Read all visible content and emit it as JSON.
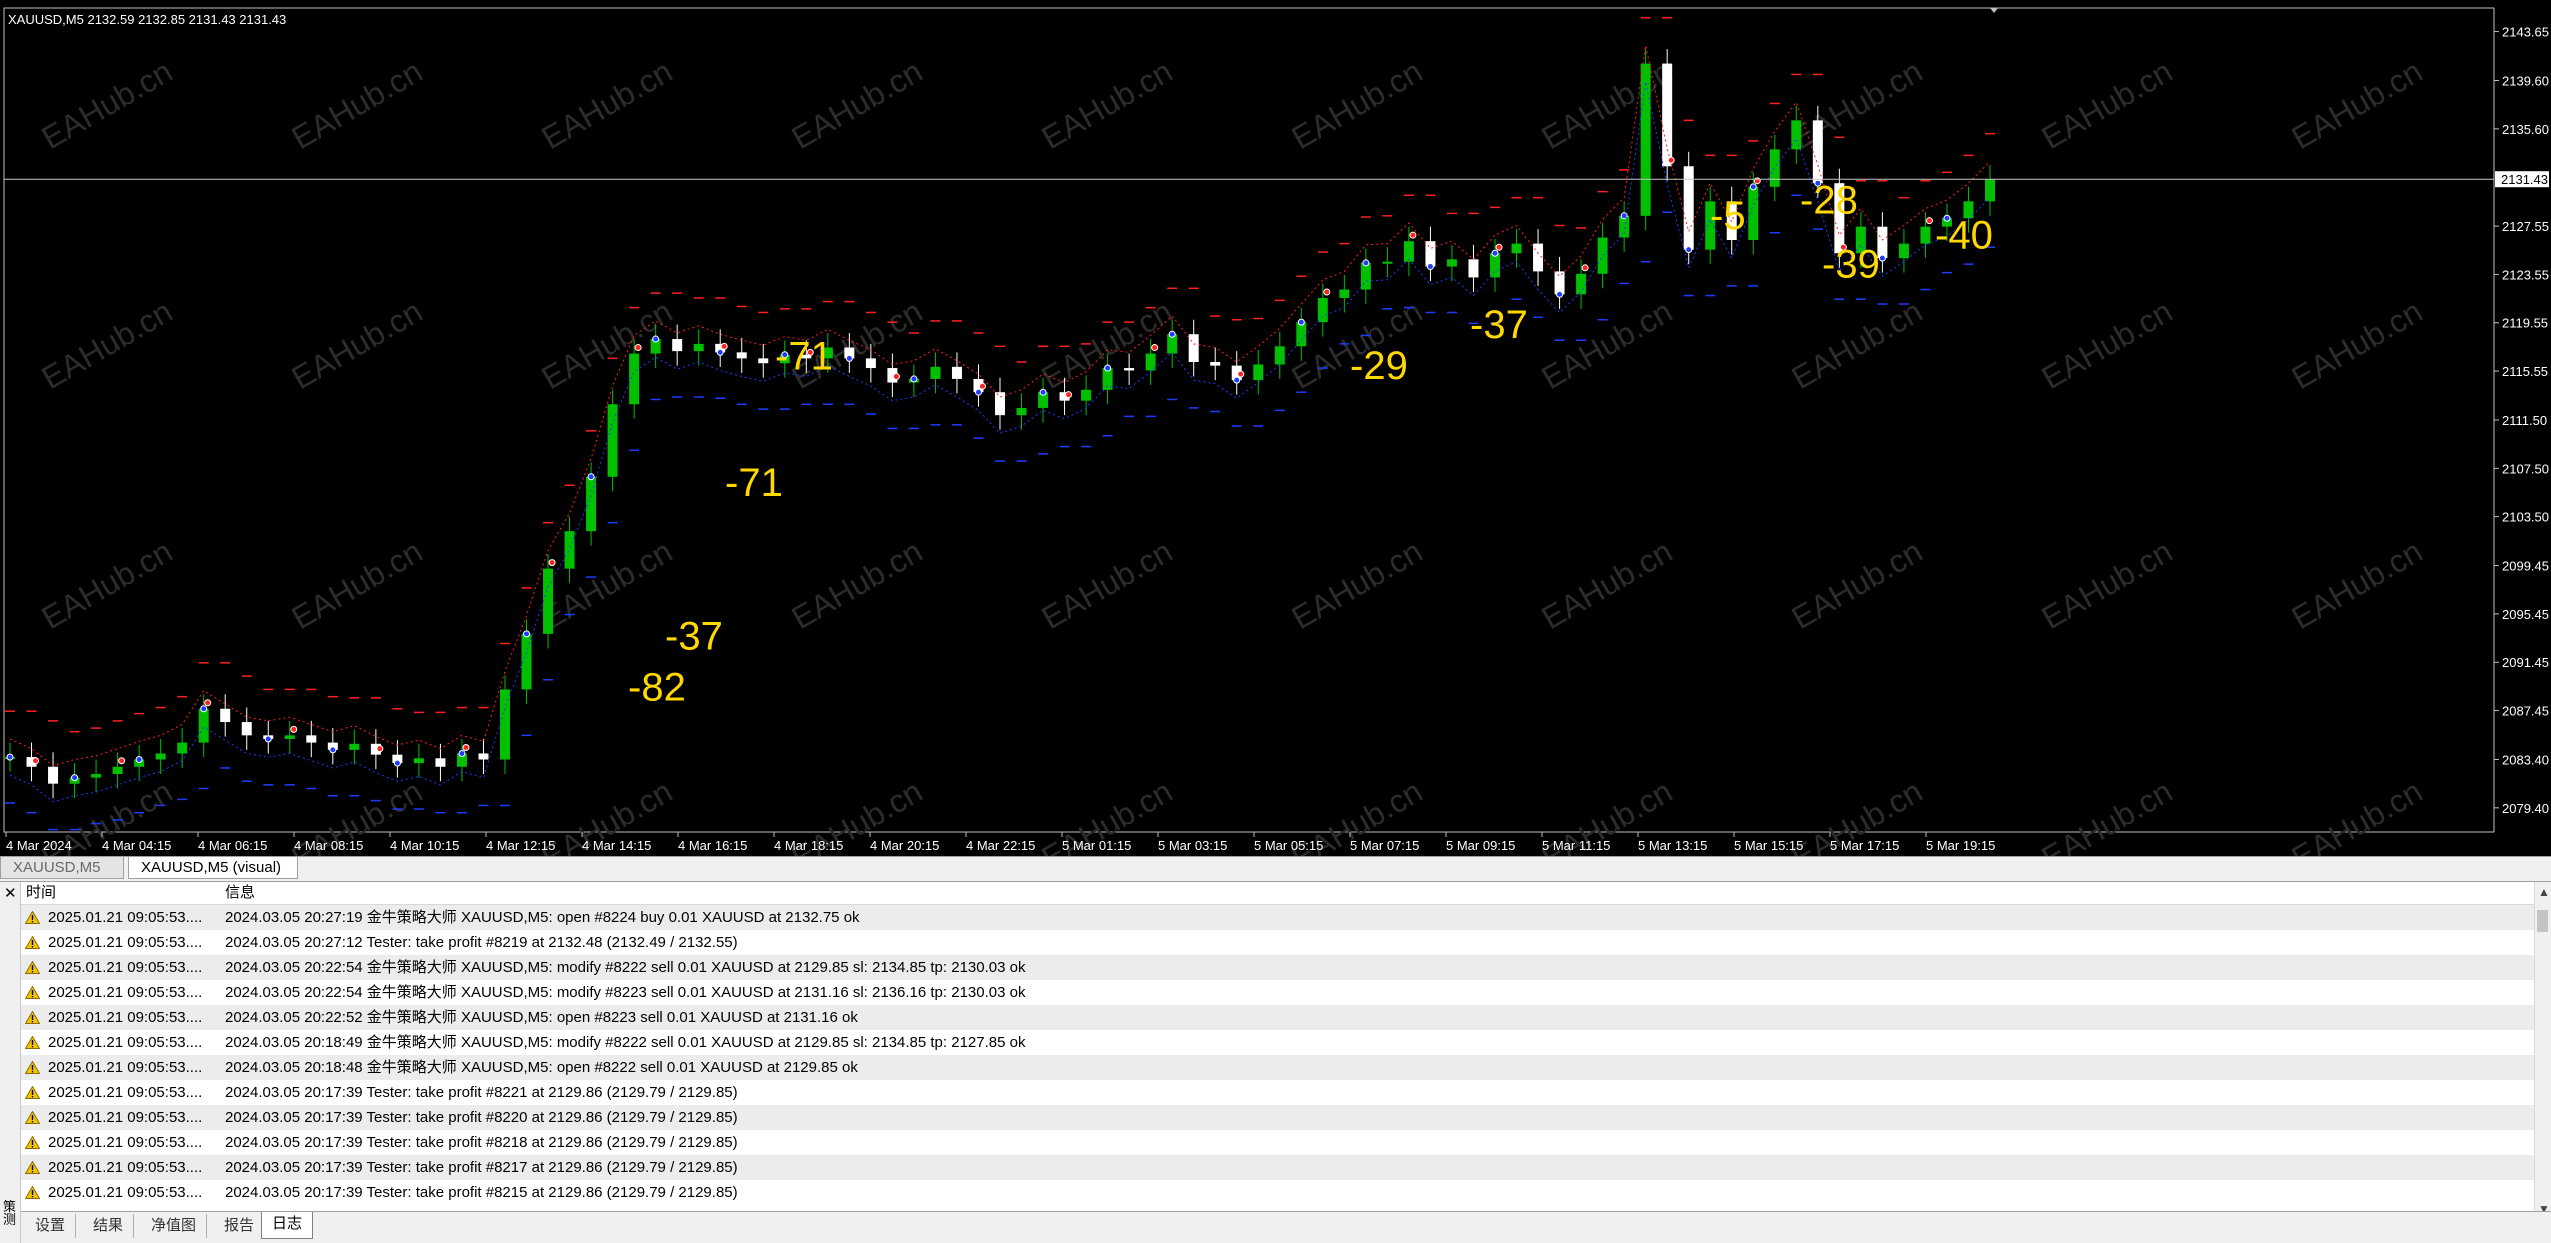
{
  "chart": {
    "header": "XAUUSD,M5  2132.59 2132.85 2131.43 2131.43",
    "current_price_label": "2131.43",
    "price_levels": [
      "2143.65",
      "2139.60",
      "2135.60",
      "2127.55",
      "2123.55",
      "2119.55",
      "2115.55",
      "2111.50",
      "2107.50",
      "2103.50",
      "2099.45",
      "2095.45",
      "2091.45",
      "2087.45",
      "2083.40",
      "2079.40"
    ],
    "time_labels": [
      "4 Mar 2024",
      "4 Mar 04:15",
      "4 Mar 06:15",
      "4 Mar 08:15",
      "4 Mar 10:15",
      "4 Mar 12:15",
      "4 Mar 14:15",
      "4 Mar 16:15",
      "4 Mar 18:15",
      "4 Mar 20:15",
      "4 Mar 22:15",
      "5 Mar 01:15",
      "5 Mar 03:15",
      "5 Mar 05:15",
      "5 Mar 07:15",
      "5 Mar 09:15",
      "5 Mar 11:15",
      "5 Mar 13:15",
      "5 Mar 15:15",
      "5 Mar 17:15",
      "5 Mar 19:15"
    ],
    "profit_labels": [
      "-82",
      "-37",
      "-71",
      "-71",
      "-29",
      "-37",
      "-5",
      "-28",
      "-39",
      "-40"
    ],
    "watermark": "EAHub.cn",
    "price_series": [
      2083.6,
      2082.8,
      2081.4,
      2081.9,
      2082.2,
      2082.8,
      2083.4,
      2083.9,
      2084.8,
      2087.6,
      2086.5,
      2085.4,
      2085.1,
      2085.4,
      2084.8,
      2084.2,
      2084.7,
      2083.8,
      2083.1,
      2083.5,
      2082.8,
      2083.9,
      2083.4,
      2089.2,
      2093.8,
      2099.2,
      2102.3,
      2106.8,
      2112.8,
      2117.0,
      2118.2,
      2117.2,
      2117.8,
      2117.1,
      2116.6,
      2116.2,
      2116.9,
      2116.6,
      2117.5,
      2116.6,
      2115.8,
      2114.6,
      2114.9,
      2115.9,
      2114.9,
      2113.8,
      2111.9,
      2112.5,
      2113.8,
      2113.1,
      2114.0,
      2115.8,
      2115.6,
      2117.0,
      2118.6,
      2116.3,
      2116.0,
      2114.8,
      2116.1,
      2117.6,
      2119.6,
      2121.6,
      2122.3,
      2124.5,
      2124.6,
      2126.3,
      2124.2,
      2124.8,
      2123.3,
      2125.3,
      2126.1,
      2123.8,
      2121.9,
      2123.6,
      2126.6,
      2128.4,
      2141.0,
      2132.5,
      2125.6,
      2129.6,
      2126.4,
      2130.8,
      2133.9,
      2136.3,
      2131.1,
      2125.3,
      2127.5,
      2124.9,
      2126.1,
      2127.5,
      2128.2,
      2129.6,
      2131.4
    ],
    "colors": {
      "background": "#000000",
      "grid_text": "#ffffff",
      "bull": "#00c000",
      "bear": "#ffffff",
      "buy": "#1e3cff",
      "sell": "#ff2020",
      "profit_text": "#ffd800"
    }
  },
  "tabs": {
    "chart_tab_1": "XAUUSD,M5",
    "chart_tab_2": "XAUUSD,M5 (visual)"
  },
  "log": {
    "col_time": "时间",
    "col_info": "信息",
    "side_label": "策测",
    "rows": [
      {
        "time": "2025.01.21 09:05:53....",
        "msg": "2024.03.05 20:27:19  金牛策略大师 XAUUSD,M5: open #8224 buy 0.01 XAUUSD at 2132.75 ok"
      },
      {
        "time": "2025.01.21 09:05:53....",
        "msg": "2024.03.05 20:27:12  Tester: take profit #8219 at 2132.48 (2132.49 / 2132.55)"
      },
      {
        "time": "2025.01.21 09:05:53....",
        "msg": "2024.03.05 20:22:54  金牛策略大师 XAUUSD,M5: modify #8222 sell 0.01 XAUUSD at 2129.85 sl: 2134.85 tp: 2130.03 ok"
      },
      {
        "time": "2025.01.21 09:05:53....",
        "msg": "2024.03.05 20:22:54  金牛策略大师 XAUUSD,M5: modify #8223 sell 0.01 XAUUSD at 2131.16 sl: 2136.16 tp: 2130.03 ok"
      },
      {
        "time": "2025.01.21 09:05:53....",
        "msg": "2024.03.05 20:22:52  金牛策略大师 XAUUSD,M5: open #8223 sell 0.01 XAUUSD at 2131.16 ok"
      },
      {
        "time": "2025.01.21 09:05:53....",
        "msg": "2024.03.05 20:18:49  金牛策略大师 XAUUSD,M5: modify #8222 sell 0.01 XAUUSD at 2129.85 sl: 2134.85 tp: 2127.85 ok"
      },
      {
        "time": "2025.01.21 09:05:53....",
        "msg": "2024.03.05 20:18:48  金牛策略大师 XAUUSD,M5: open #8222 sell 0.01 XAUUSD at 2129.85 ok"
      },
      {
        "time": "2025.01.21 09:05:53....",
        "msg": "2024.03.05 20:17:39  Tester: take profit #8221 at 2129.86 (2129.79 / 2129.85)"
      },
      {
        "time": "2025.01.21 09:05:53....",
        "msg": "2024.03.05 20:17:39  Tester: take profit #8220 at 2129.86 (2129.79 / 2129.85)"
      },
      {
        "time": "2025.01.21 09:05:53....",
        "msg": "2024.03.05 20:17:39  Tester: take profit #8218 at 2129.86 (2129.79 / 2129.85)"
      },
      {
        "time": "2025.01.21 09:05:53....",
        "msg": "2024.03.05 20:17:39  Tester: take profit #8217 at 2129.86 (2129.79 / 2129.85)"
      },
      {
        "time": "2025.01.21 09:05:53....",
        "msg": "2024.03.05 20:17:39  Tester: take profit #8215 at 2129.86 (2129.79 / 2129.85)"
      }
    ]
  },
  "bottom_tabs": [
    "设置",
    "结果",
    "净值图",
    "报告",
    "日志"
  ]
}
